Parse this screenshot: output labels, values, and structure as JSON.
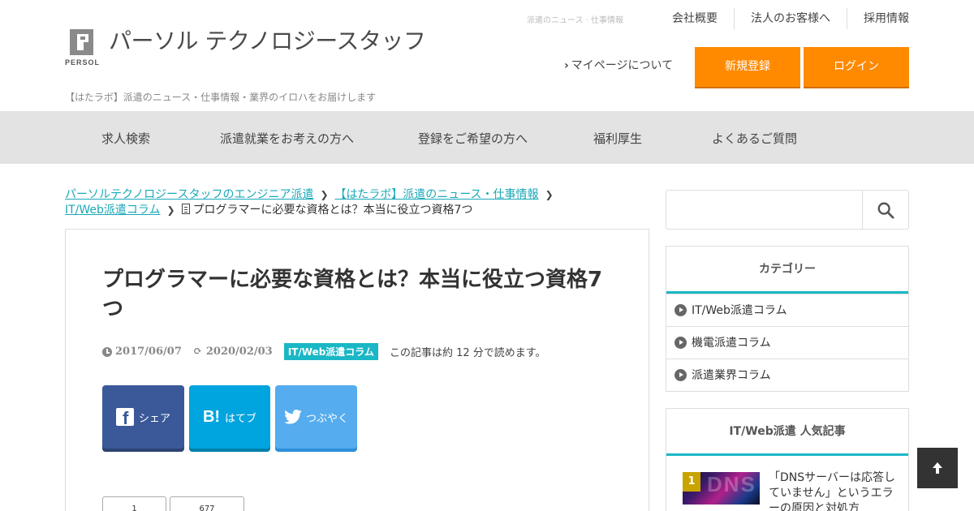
{
  "header": {
    "logo_mark_text": "PERSOL",
    "logo_text": "パーソル テクノロジースタッフ",
    "tagline": "【はたラボ】派遣のニュース・仕事情報・業界のイロハをお届けします",
    "top_links": {
      "news": "派遣のニュース · 仕事情報",
      "company": "会社概要",
      "corporate": "法人のお客様へ",
      "recruit": "採用情報"
    },
    "mypage": "マイページについて",
    "register": "新規登録",
    "login": "ログイン"
  },
  "nav": [
    "求人検索",
    "派遣就業をお考えの方へ",
    "登録をご希望の方へ",
    "福利厚生",
    "よくあるご質問"
  ],
  "breadcrumb": {
    "crumb1": "パーソルテクノロジースタッフのエンジニア派遣",
    "crumb2": "【はたラボ】派遣のニュース・仕事情報",
    "crumb3": "IT/Web派遣コラム",
    "current": "プログラマーに必要な資格とは？本当に役立つ資格7つ"
  },
  "article": {
    "title": "プログラマーに必要な資格とは？本当に役立つ資格7つ",
    "published": "2017/06/07",
    "updated": "2020/02/03",
    "category": "IT/Web派遣コラム",
    "read_time": "この記事は約 12 分で読めます。",
    "share": {
      "facebook": "シェア",
      "hatena": "はてブ",
      "twitter": "つぶやく"
    },
    "counts": [
      "1",
      "677"
    ]
  },
  "sidebar": {
    "search_placeholder": "",
    "categories_title": "カテゴリー",
    "categories": [
      "IT/Web派遣コラム",
      "機電派遣コラム",
      "派遣業界コラム"
    ],
    "popular_title": "IT/Web派遣 人気記事",
    "popular": [
      {
        "rank": "1",
        "thumb_text": "DNS",
        "title": "「DNSサーバーは応答していません」というエラーの原因と対処方"
      }
    ]
  },
  "colors": {
    "accent_orange": "#ff8a00",
    "accent_teal": "#1ab7c6",
    "facebook": "#3b5998",
    "hatena": "#00a4de",
    "twitter": "#55acee"
  }
}
